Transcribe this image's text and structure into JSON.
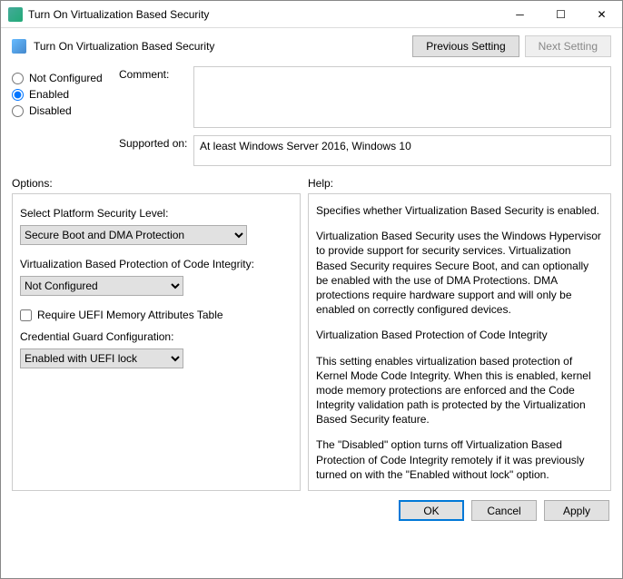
{
  "window": {
    "title": "Turn On Virtualization Based Security"
  },
  "header": {
    "title": "Turn On Virtualization Based Security",
    "prev": "Previous Setting",
    "next": "Next Setting"
  },
  "state": {
    "not_configured": "Not Configured",
    "enabled": "Enabled",
    "disabled": "Disabled",
    "selected": "enabled"
  },
  "labels": {
    "comment": "Comment:",
    "supported": "Supported on:",
    "options": "Options:",
    "help": "Help:"
  },
  "supported_text": "At least Windows Server 2016, Windows 10",
  "options": {
    "platform_label": "Select Platform Security Level:",
    "platform_value": "Secure Boot and DMA Protection",
    "vbpci_label": "Virtualization Based Protection of Code Integrity:",
    "vbpci_value": "Not Configured",
    "uefi_check": "Require UEFI Memory Attributes Table",
    "cred_label": "Credential Guard Configuration:",
    "cred_value": "Enabled with UEFI lock"
  },
  "help": {
    "p1": "Specifies whether Virtualization Based Security is enabled.",
    "p2": "Virtualization Based Security uses the Windows Hypervisor to provide support for security services. Virtualization Based Security requires Secure Boot, and can optionally be enabled with the use of DMA Protections. DMA protections require hardware support and will only be enabled on correctly configured devices.",
    "p3": "Virtualization Based Protection of Code Integrity",
    "p4": "This setting enables virtualization based protection of Kernel Mode Code Integrity. When this is enabled, kernel mode memory protections are enforced and the Code Integrity validation path is protected by the Virtualization Based Security feature.",
    "p5": "The \"Disabled\" option turns off Virtualization Based Protection of Code Integrity remotely if it was previously turned on with the \"Enabled without lock\" option."
  },
  "footer": {
    "ok": "OK",
    "cancel": "Cancel",
    "apply": "Apply"
  }
}
